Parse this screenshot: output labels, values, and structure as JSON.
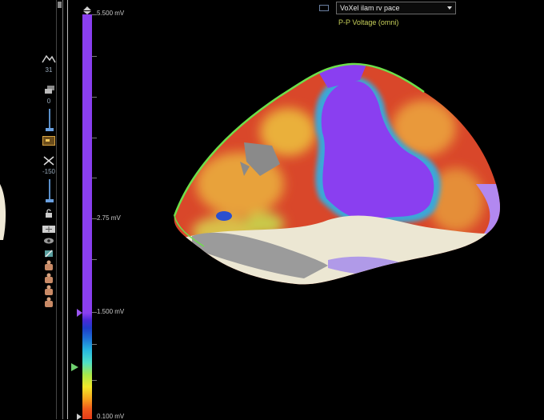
{
  "left_toolbar": {
    "peak_value": "31",
    "opacity_value": "0",
    "clip_value": "-150"
  },
  "colorbar": {
    "max_label": "5.500 mV",
    "mid_label": "2.75 mV",
    "threshold_label": "1.500 mV",
    "min_label": "0.100 mV"
  },
  "map_selector": {
    "selected": "VoXel ilam rv pace"
  },
  "map_type_label": "P-P Voltage (omni)",
  "colors": {
    "purple": "#8a3ff0",
    "red": "#e63a18",
    "label_yellow": "#c8d05a"
  }
}
